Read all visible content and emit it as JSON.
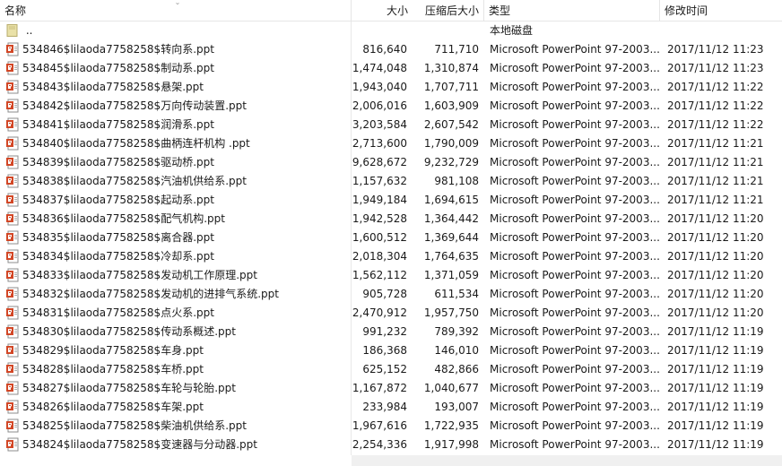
{
  "columns": {
    "name": "名称",
    "size": "大小",
    "compressed": "压缩后大小",
    "type": "类型",
    "modified": "修改时间"
  },
  "sort": {
    "column": "name",
    "direction": "ascending"
  },
  "parent_row": {
    "name": "..",
    "type": "本地磁盘",
    "icon": "folder-up-icon"
  },
  "files": [
    {
      "name": "534846$lilaoda7758258$转向系.ppt",
      "size": "816,640",
      "compressed": "711,710",
      "type": "Microsoft PowerPoint 97-2003...",
      "modified": "2017/11/12 11:23",
      "icon": "powerpoint-file-icon"
    },
    {
      "name": "534845$lilaoda7758258$制动系.ppt",
      "size": "1,474,048",
      "compressed": "1,310,874",
      "type": "Microsoft PowerPoint 97-2003...",
      "modified": "2017/11/12 11:23",
      "icon": "powerpoint-file-icon"
    },
    {
      "name": "534843$lilaoda7758258$悬架.ppt",
      "size": "1,943,040",
      "compressed": "1,707,711",
      "type": "Microsoft PowerPoint 97-2003...",
      "modified": "2017/11/12 11:22",
      "icon": "powerpoint-file-icon"
    },
    {
      "name": "534842$lilaoda7758258$万向传动装置.ppt",
      "size": "2,006,016",
      "compressed": "1,603,909",
      "type": "Microsoft PowerPoint 97-2003...",
      "modified": "2017/11/12 11:22",
      "icon": "powerpoint-file-icon"
    },
    {
      "name": "534841$lilaoda7758258$润滑系.ppt",
      "size": "3,203,584",
      "compressed": "2,607,542",
      "type": "Microsoft PowerPoint 97-2003...",
      "modified": "2017/11/12 11:22",
      "icon": "powerpoint-file-icon"
    },
    {
      "name": "534840$lilaoda7758258$曲柄连杆机构 .ppt",
      "size": "2,713,600",
      "compressed": "1,790,009",
      "type": "Microsoft PowerPoint 97-2003...",
      "modified": "2017/11/12 11:21",
      "icon": "powerpoint-file-icon"
    },
    {
      "name": "534839$lilaoda7758258$驱动桥.ppt",
      "size": "9,628,672",
      "compressed": "9,232,729",
      "type": "Microsoft PowerPoint 97-2003...",
      "modified": "2017/11/12 11:21",
      "icon": "powerpoint-file-icon"
    },
    {
      "name": "534838$lilaoda7758258$汽油机供给系.ppt",
      "size": "1,157,632",
      "compressed": "981,108",
      "type": "Microsoft PowerPoint 97-2003...",
      "modified": "2017/11/12 11:21",
      "icon": "powerpoint-file-icon"
    },
    {
      "name": "534837$lilaoda7758258$起动系.ppt",
      "size": "1,949,184",
      "compressed": "1,694,615",
      "type": "Microsoft PowerPoint 97-2003...",
      "modified": "2017/11/12 11:21",
      "icon": "powerpoint-file-icon"
    },
    {
      "name": "534836$lilaoda7758258$配气机构.ppt",
      "size": "1,942,528",
      "compressed": "1,364,442",
      "type": "Microsoft PowerPoint 97-2003...",
      "modified": "2017/11/12 11:20",
      "icon": "powerpoint-file-icon"
    },
    {
      "name": "534835$lilaoda7758258$离合器.ppt",
      "size": "1,600,512",
      "compressed": "1,369,644",
      "type": "Microsoft PowerPoint 97-2003...",
      "modified": "2017/11/12 11:20",
      "icon": "powerpoint-file-icon"
    },
    {
      "name": "534834$lilaoda7758258$冷却系.ppt",
      "size": "2,018,304",
      "compressed": "1,764,635",
      "type": "Microsoft PowerPoint 97-2003...",
      "modified": "2017/11/12 11:20",
      "icon": "powerpoint-file-icon"
    },
    {
      "name": "534833$lilaoda7758258$发动机工作原理.ppt",
      "size": "1,562,112",
      "compressed": "1,371,059",
      "type": "Microsoft PowerPoint 97-2003...",
      "modified": "2017/11/12 11:20",
      "icon": "powerpoint-file-icon"
    },
    {
      "name": "534832$lilaoda7758258$发动机的进排气系统.ppt",
      "size": "905,728",
      "compressed": "611,534",
      "type": "Microsoft PowerPoint 97-2003...",
      "modified": "2017/11/12 11:20",
      "icon": "powerpoint-file-icon"
    },
    {
      "name": "534831$lilaoda7758258$点火系.ppt",
      "size": "2,470,912",
      "compressed": "1,957,750",
      "type": "Microsoft PowerPoint 97-2003...",
      "modified": "2017/11/12 11:20",
      "icon": "powerpoint-file-icon"
    },
    {
      "name": "534830$lilaoda7758258$传动系概述.ppt",
      "size": "991,232",
      "compressed": "789,392",
      "type": "Microsoft PowerPoint 97-2003...",
      "modified": "2017/11/12 11:19",
      "icon": "powerpoint-file-icon"
    },
    {
      "name": "534829$lilaoda7758258$车身.ppt",
      "size": "186,368",
      "compressed": "146,010",
      "type": "Microsoft PowerPoint 97-2003...",
      "modified": "2017/11/12 11:19",
      "icon": "powerpoint-file-icon"
    },
    {
      "name": "534828$lilaoda7758258$车桥.ppt",
      "size": "625,152",
      "compressed": "482,866",
      "type": "Microsoft PowerPoint 97-2003...",
      "modified": "2017/11/12 11:19",
      "icon": "powerpoint-file-icon"
    },
    {
      "name": "534827$lilaoda7758258$车轮与轮胎.ppt",
      "size": "1,167,872",
      "compressed": "1,040,677",
      "type": "Microsoft PowerPoint 97-2003...",
      "modified": "2017/11/12 11:19",
      "icon": "powerpoint-file-icon"
    },
    {
      "name": "534826$lilaoda7758258$车架.ppt",
      "size": "233,984",
      "compressed": "193,007",
      "type": "Microsoft PowerPoint 97-2003...",
      "modified": "2017/11/12 11:19",
      "icon": "powerpoint-file-icon"
    },
    {
      "name": "534825$lilaoda7758258$柴油机供给系.ppt",
      "size": "1,967,616",
      "compressed": "1,722,935",
      "type": "Microsoft PowerPoint 97-2003...",
      "modified": "2017/11/12 11:19",
      "icon": "powerpoint-file-icon"
    },
    {
      "name": "534824$lilaoda7758258$变速器与分动器.ppt",
      "size": "2,254,336",
      "compressed": "1,917,998",
      "type": "Microsoft PowerPoint 97-2003...",
      "modified": "2017/11/12 11:19",
      "icon": "powerpoint-file-icon"
    }
  ]
}
